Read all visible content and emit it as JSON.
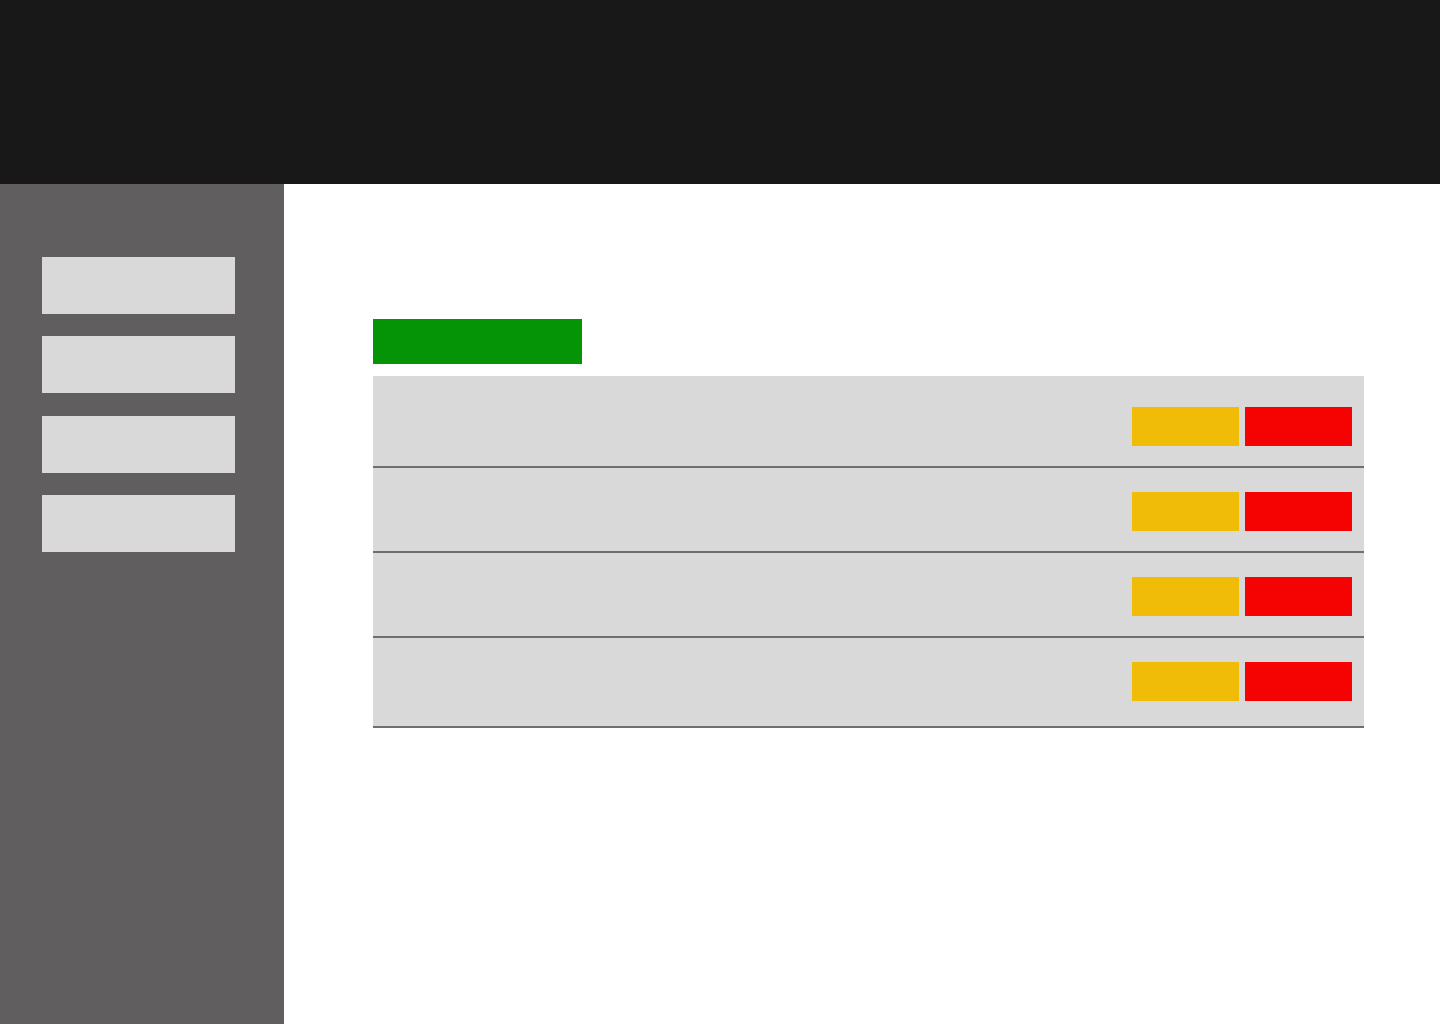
{
  "colors": {
    "topbar": "#181818",
    "sidebar": "#605e5f",
    "nav_item": "#d9d9d9",
    "add_button": "#059405",
    "table_row": "#d9d9d9",
    "row_divider": "#6f6f6f",
    "edit_button": "#f1bc07",
    "delete_button": "#f50303"
  },
  "sidebar": {
    "items": [
      {
        "label": ""
      },
      {
        "label": ""
      },
      {
        "label": ""
      },
      {
        "label": ""
      }
    ]
  },
  "main": {
    "add_button_label": "",
    "rows": [
      {
        "edit_label": "",
        "delete_label": ""
      },
      {
        "edit_label": "",
        "delete_label": ""
      },
      {
        "edit_label": "",
        "delete_label": ""
      },
      {
        "edit_label": "",
        "delete_label": ""
      }
    ]
  }
}
